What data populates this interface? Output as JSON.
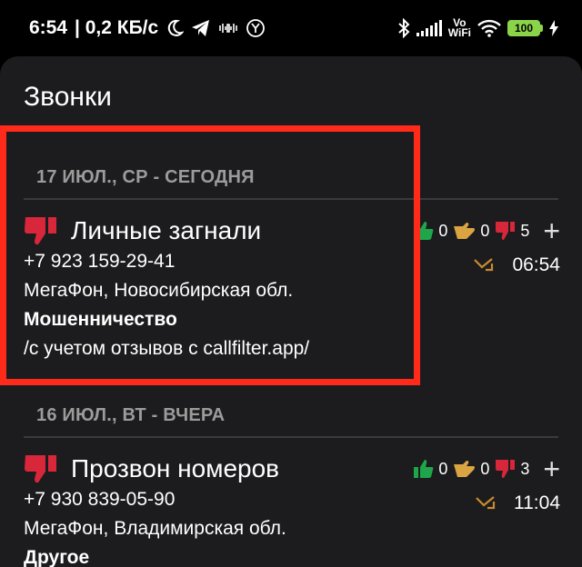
{
  "status_bar": {
    "time": "6:54",
    "speed": "| 0,2 КБ/с",
    "vowifi_top": "Vo",
    "vowifi_bottom": "WiFi",
    "battery": "100"
  },
  "screen": {
    "title": "Звонки"
  },
  "groups": [
    {
      "date": "17 ИЮЛ., СР - СЕГОДНЯ",
      "call": {
        "name": "Личные загнали",
        "phone": "+7 923 159-29-41",
        "operator": "МегаФон, Новосибирская обл.",
        "category": "Мошенничество",
        "note": "/с учетом отзывов с callfilter.app/",
        "likes": "0",
        "neutral": "0",
        "dislikes": "5",
        "time": "06:54"
      }
    },
    {
      "date": "16 ИЮЛ., ВТ - ВЧЕРА",
      "call": {
        "name": "Прозвон номеров",
        "phone": "+7 930 839-05-90",
        "operator": "МегаФон, Владимирская обл.",
        "category": "Другое",
        "likes": "0",
        "neutral": "0",
        "dislikes": "3",
        "time": "11:04"
      }
    }
  ],
  "colors": {
    "highlight": "#ff2a1a",
    "thumb_up": "#1fa64a",
    "thumb_neutral": "#d9a441",
    "thumb_down": "#d8263a",
    "missed_arrow": "#c98a2e",
    "battery": "#8bd44a"
  },
  "icons": [
    "moon-icon",
    "telegram-icon",
    "vibrate-icon",
    "y-icon",
    "bluetooth-icon",
    "signal-icon",
    "wifi-icon",
    "battery-icon",
    "charging-icon",
    "thumb-down-icon",
    "thumb-up-icon",
    "thumb-neutral-icon",
    "plus-icon",
    "missed-call-arrow-icon"
  ]
}
